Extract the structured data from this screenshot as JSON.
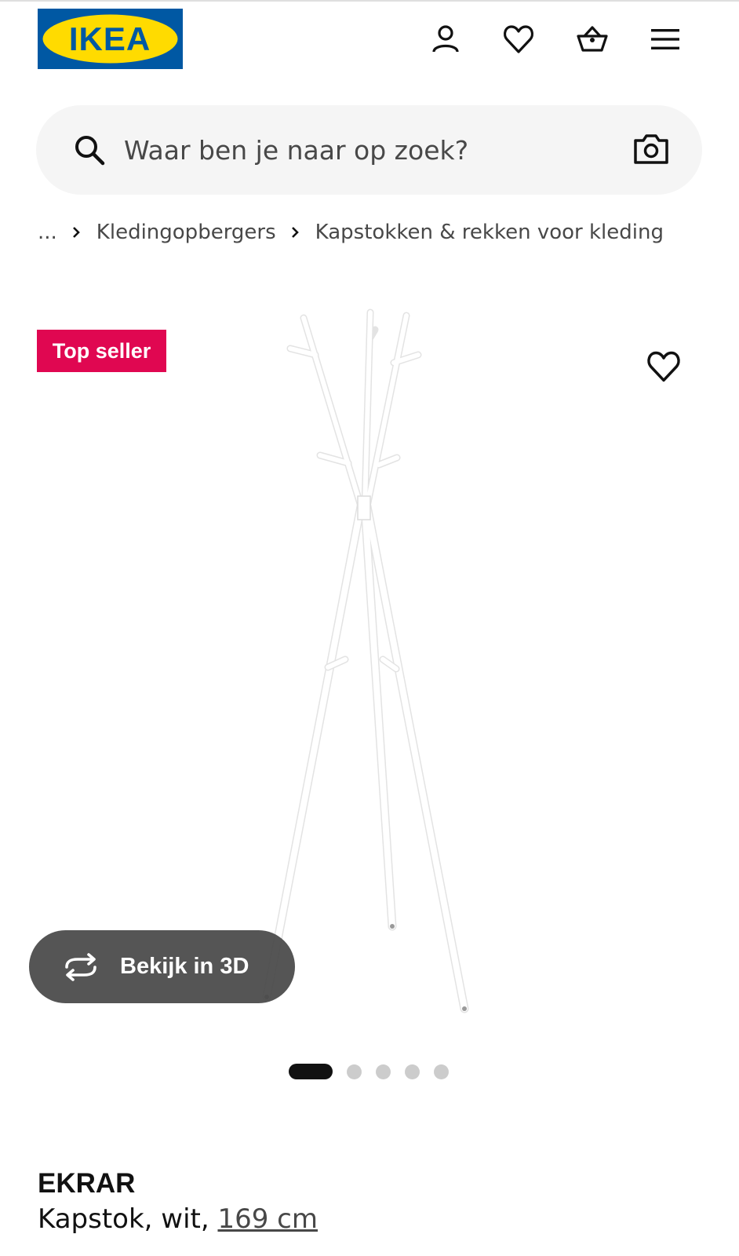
{
  "brand": {
    "name": "IKEA",
    "color_blue": "#0058a3",
    "color_yellow": "#ffdb00"
  },
  "header": {
    "icons": [
      "profile-icon",
      "heart-icon",
      "basket-icon",
      "hamburger-menu-icon"
    ]
  },
  "search": {
    "placeholder": "Waar ben je naar op zoek?",
    "value": ""
  },
  "breadcrumb": {
    "ellipsis": "...",
    "items": [
      "Kledingopbergers",
      "Kapstokken & rekken voor kleding"
    ]
  },
  "gallery": {
    "badge": "Top seller",
    "badge_color": "#e00751",
    "view3d_label": "Bekijk in 3D",
    "image_count": 5,
    "active_index": 0
  },
  "product": {
    "name": "EKRAR",
    "description": "Kapstok, wit, ",
    "size": "169 cm"
  }
}
